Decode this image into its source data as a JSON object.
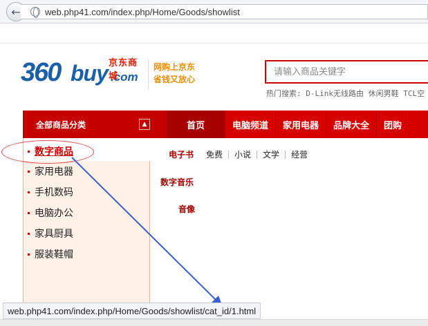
{
  "browser": {
    "url": "web.php41.com/index.php/Home/Goods/showlist",
    "status_url": "web.php41.com/index.php/Home/Goods/showlist/cat_id/1.html"
  },
  "header": {
    "logo": {
      "number": "360",
      "buy": "buy",
      "com": ".com",
      "cn": "京东商城"
    },
    "slogan": {
      "line1": "网购上京东",
      "line2": "省钱又放心"
    },
    "search": {
      "placeholder": "请输入商品关键字"
    },
    "hot_keywords": "热门搜索: D-Link无线路由 休闲男鞋 TCL空"
  },
  "nav": {
    "all_categories": "全部商品分类",
    "items": [
      {
        "label": "首页",
        "active": true
      },
      {
        "label": "电脑频道"
      },
      {
        "label": "家用电器"
      },
      {
        "label": "品牌大全"
      },
      {
        "label": "团购"
      }
    ]
  },
  "categories": [
    {
      "label": "数字商品",
      "active": true
    },
    {
      "label": "家用电器"
    },
    {
      "label": "手机数码"
    },
    {
      "label": "电脑办公"
    },
    {
      "label": "家具厨具"
    },
    {
      "label": "服装鞋帽"
    }
  ],
  "subcategories": [
    {
      "title": "电子书",
      "links": [
        "免费",
        "小说",
        "文学",
        "经营"
      ]
    },
    {
      "title": "数字音乐",
      "links": []
    },
    {
      "title": "音像",
      "links": []
    }
  ],
  "colors": {
    "brand_red": "#d60000",
    "logo_blue": "#1a5fa8",
    "annotation_arrow": "#3a5fd0"
  }
}
